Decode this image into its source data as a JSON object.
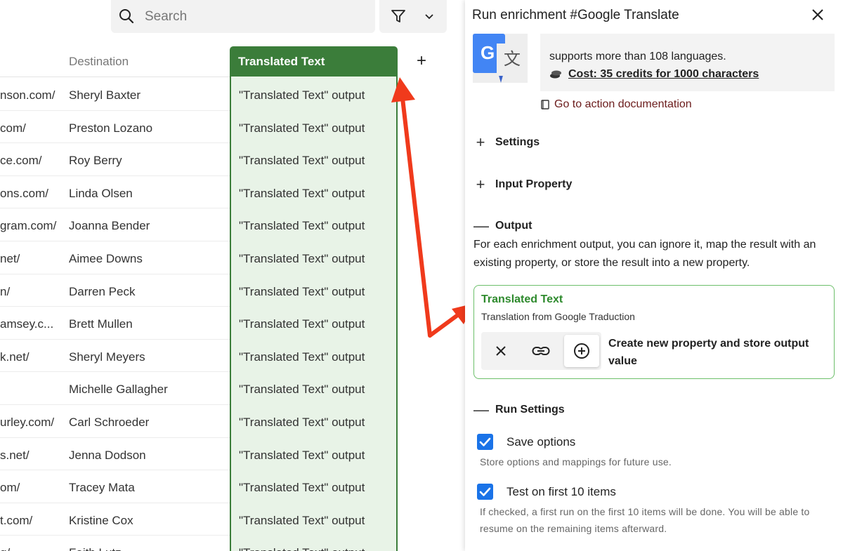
{
  "search": {
    "placeholder": "Search"
  },
  "table": {
    "destination_header": "Destination",
    "translated_header": "Translated Text",
    "add_column": "+",
    "rows": [
      {
        "url": "nson.com/",
        "destination": "Sheryl Baxter",
        "translated": "\"Translated Text\" output"
      },
      {
        "url": "com/",
        "destination": "Preston Lozano",
        "translated": "\"Translated Text\" output"
      },
      {
        "url": "ce.com/",
        "destination": "Roy Berry",
        "translated": "\"Translated Text\" output"
      },
      {
        "url": "ons.com/",
        "destination": "Linda Olsen",
        "translated": "\"Translated Text\" output"
      },
      {
        "url": "gram.com/",
        "destination": "Joanna Bender",
        "translated": "\"Translated Text\" output"
      },
      {
        "url": "net/",
        "destination": "Aimee Downs",
        "translated": "\"Translated Text\" output"
      },
      {
        "url": "n/",
        "destination": "Darren Peck",
        "translated": "\"Translated Text\" output"
      },
      {
        "url": "amsey.c...",
        "destination": "Brett Mullen",
        "translated": "\"Translated Text\" output"
      },
      {
        "url": "k.net/",
        "destination": "Sheryl Meyers",
        "translated": "\"Translated Text\" output"
      },
      {
        "url": "",
        "destination": "Michelle Gallagher",
        "translated": "\"Translated Text\" output"
      },
      {
        "url": "urley.com/",
        "destination": "Carl Schroeder",
        "translated": "\"Translated Text\" output"
      },
      {
        "url": "s.net/",
        "destination": "Jenna Dodson",
        "translated": "\"Translated Text\" output"
      },
      {
        "url": "om/",
        "destination": "Tracey Mata",
        "translated": "\"Translated Text\" output"
      },
      {
        "url": "t.com/",
        "destination": "Kristine Cox",
        "translated": "\"Translated Text\" output"
      },
      {
        "url": "g/",
        "destination": "Faith Lutz",
        "translated": "\"Translated Text\" output"
      }
    ]
  },
  "panel": {
    "title": "Run enrichment #Google Translate",
    "description": "supports more than 108 languages.",
    "cost": "Cost: 35 credits for 1000 characters",
    "doc_link": "Go to action documentation",
    "settings_label": "Settings",
    "input_property_label": "Input Property",
    "output_label": "Output",
    "output_description": "For each enrichment output, you can ignore it, map the result with an existing property, or store the result into a new property.",
    "output_card": {
      "title": "Translated Text",
      "subtitle": "Translation from Google Traduction",
      "create_label": "Create new property and store output value"
    },
    "run_settings_label": "Run Settings",
    "save_options_label": "Save options",
    "save_options_hint": "Store options and mappings for future use.",
    "test_label": "Test on first 10 items",
    "test_hint": "If checked, a first run on the first 10 items will be done. You will be able to resume on the remaining items afterward."
  },
  "colors": {
    "accent_green": "#3b7d3a",
    "light_green": "#e8f3e7",
    "checkbox_blue": "#1a73e8",
    "arrow_red": "#f03a1c"
  },
  "icons": [
    "search-icon",
    "filter-icon",
    "chevron-down-icon",
    "plus-icon",
    "close-icon",
    "google-translate-logo",
    "coins-icon",
    "book-icon",
    "ignore-icon",
    "link-icon",
    "add-circle-icon",
    "checkbox-icon"
  ]
}
